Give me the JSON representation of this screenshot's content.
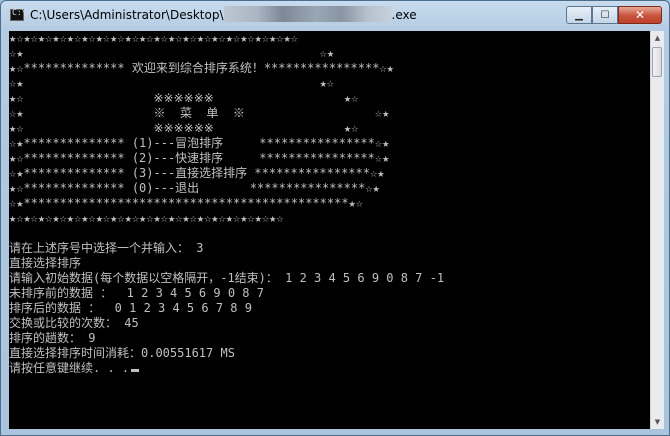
{
  "window": {
    "title_prefix": "C:\\Users\\Administrator\\Desktop\\",
    "title_suffix": ".exe",
    "minimize_glyph": "▁",
    "maximize_glyph": "☐",
    "close_glyph": "✕"
  },
  "console": {
    "lines": [
      "★☆★☆★☆★☆★☆★☆★☆★☆★☆★☆★☆★☆★☆★☆★☆★☆★☆★☆★☆★☆",
      "☆★                                         ☆★",
      "★☆************** 欢迎来到综合排序系统！****************☆★",
      "☆★                                         ★☆",
      "★☆                  ※※※※※※                  ★☆",
      "☆★                  ※  菜  单  ※                  ☆★",
      "★☆                  ※※※※※※                  ★☆",
      "☆★************** (1)---冒泡排序     ****************☆★",
      "★☆************** (2)---快速排序     ****************☆★",
      "☆★************** (3)---直接选择排序 ****************☆★",
      "★☆************** (0)---退出       ****************☆★",
      "☆★*********************************************★☆",
      "★☆★☆★☆★☆★☆★☆★☆★☆★☆★☆★☆★☆★☆★☆★☆★☆★☆★☆★☆",
      "",
      "请在上述序号中选择一个并输入： 3",
      "直接选择排序",
      "请输入初始数据(每个数据以空格隔开，-1结束)： 1 2 3 4 5 6 9 0 8 7 -1",
      "未排序前的数据 ：  1 2 3 4 5 6 9 0 8 7",
      "排序后的数据 ：  0 1 2 3 4 5 6 7 8 9",
      "交换或比较的次数： 45",
      "排序的趟数： 9",
      "直接选择排序时间消耗：0.00551617 MS",
      "请按任意键继续. . ."
    ]
  }
}
